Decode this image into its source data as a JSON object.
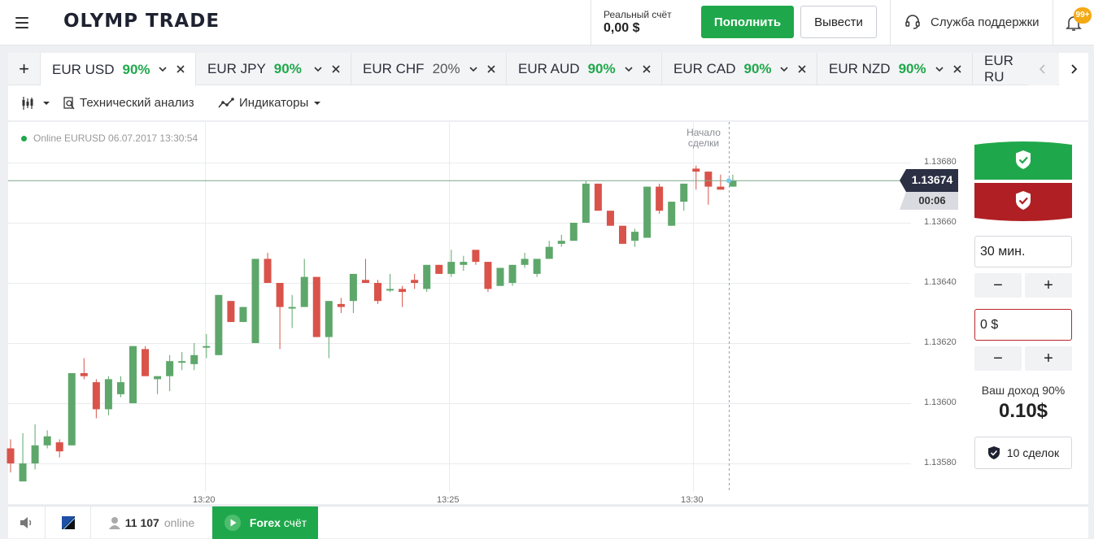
{
  "header": {
    "logo_text": "OLYMP TRADE",
    "account_label": "Реальный счёт",
    "account_balance": "0,00 $",
    "deposit_label": "Пополнить",
    "withdraw_label": "Вывести",
    "support_label": "Служба поддержки",
    "notifications_badge": "99+"
  },
  "tabs": [
    {
      "pair": "EUR USD",
      "payout": "90%",
      "active": true
    },
    {
      "pair": "EUR JPY",
      "payout": "90%"
    },
    {
      "pair": "EUR CHF",
      "payout": "20%"
    },
    {
      "pair": "EUR AUD",
      "payout": "90%"
    },
    {
      "pair": "EUR CAD",
      "payout": "90%"
    },
    {
      "pair": "EUR NZD",
      "payout": "90%"
    },
    {
      "pair": "EUR RU",
      "payout": ""
    }
  ],
  "toolbar": {
    "technical_label": "Технический анализ",
    "indicators_label": "Индикаторы"
  },
  "chart": {
    "online_text": "Online EURUSD 06.07.2017 13:30:54",
    "deal_start_line1": "Начало",
    "deal_start_line2": "сделки",
    "current_price": "1.13674",
    "countdown": "00:06",
    "y_ticks": [
      "1.13680",
      "1.13660",
      "1.13640",
      "1.13620",
      "1.13600",
      "1.13580"
    ],
    "x_ticks": [
      "13:20",
      "13:25",
      "13:30"
    ]
  },
  "chart_data": {
    "type": "candlestick",
    "title": "",
    "ylim": [
      1.13572,
      1.13692
    ],
    "y_ticks": [
      1.1368,
      1.1366,
      1.1364,
      1.1362,
      1.136,
      1.1358
    ],
    "x_ticks": [
      "13:20",
      "13:25",
      "13:30"
    ],
    "current_price": 1.13674,
    "candles": [
      {
        "o": 1.13585,
        "c": 1.1358,
        "h": 1.13588,
        "l": 1.13577
      },
      {
        "o": 1.13574,
        "c": 1.1358,
        "h": 1.1359,
        "l": 1.13578
      },
      {
        "o": 1.1358,
        "c": 1.13586,
        "h": 1.13593,
        "l": 1.13578
      },
      {
        "o": 1.13586,
        "c": 1.13589,
        "h": 1.13591,
        "l": 1.13585
      },
      {
        "o": 1.13587,
        "c": 1.13584,
        "h": 1.13588,
        "l": 1.13582
      },
      {
        "o": 1.13586,
        "c": 1.1361,
        "h": 1.1361,
        "l": 1.13586
      },
      {
        "o": 1.1361,
        "c": 1.13609,
        "h": 1.13615,
        "l": 1.13608
      },
      {
        "o": 1.13607,
        "c": 1.13598,
        "h": 1.13608,
        "l": 1.13595
      },
      {
        "o": 1.13598,
        "c": 1.13608,
        "h": 1.13609,
        "l": 1.13596
      },
      {
        "o": 1.13603,
        "c": 1.13607,
        "h": 1.13609,
        "l": 1.13602
      },
      {
        "o": 1.136,
        "c": 1.13619,
        "h": 1.13619,
        "l": 1.136
      },
      {
        "o": 1.13618,
        "c": 1.13609,
        "h": 1.13619,
        "l": 1.13609
      },
      {
        "o": 1.13608,
        "c": 1.13609,
        "h": 1.13609,
        "l": 1.13603
      },
      {
        "o": 1.13609,
        "c": 1.13614,
        "h": 1.13616,
        "l": 1.13604
      },
      {
        "o": 1.13614,
        "c": 1.13614,
        "h": 1.13617,
        "l": 1.13611
      },
      {
        "o": 1.13613,
        "c": 1.13616,
        "h": 1.1362,
        "l": 1.13611
      },
      {
        "o": 1.13619,
        "c": 1.13619,
        "h": 1.13623,
        "l": 1.13615
      },
      {
        "o": 1.13616,
        "c": 1.13636,
        "h": 1.13636,
        "l": 1.13616
      },
      {
        "o": 1.13634,
        "c": 1.13627,
        "h": 1.13634,
        "l": 1.13627
      },
      {
        "o": 1.13627,
        "c": 1.13632,
        "h": 1.13632,
        "l": 1.13627
      },
      {
        "o": 1.1362,
        "c": 1.13648,
        "h": 1.13648,
        "l": 1.1362
      },
      {
        "o": 1.13648,
        "c": 1.1364,
        "h": 1.1365,
        "l": 1.1364
      },
      {
        "o": 1.1364,
        "c": 1.13632,
        "h": 1.1364,
        "l": 1.13618
      },
      {
        "o": 1.13632,
        "c": 1.13632,
        "h": 1.13636,
        "l": 1.13625
      },
      {
        "o": 1.13632,
        "c": 1.13642,
        "h": 1.13648,
        "l": 1.13632
      },
      {
        "o": 1.13642,
        "c": 1.13622,
        "h": 1.13642,
        "l": 1.13622
      },
      {
        "o": 1.13622,
        "c": 1.13634,
        "h": 1.13634,
        "l": 1.13615
      },
      {
        "o": 1.13633,
        "c": 1.13632,
        "h": 1.13635,
        "l": 1.1363
      },
      {
        "o": 1.13634,
        "c": 1.13643,
        "h": 1.13643,
        "l": 1.1363
      },
      {
        "o": 1.13641,
        "c": 1.1364,
        "h": 1.13648,
        "l": 1.1364
      },
      {
        "o": 1.1364,
        "c": 1.13634,
        "h": 1.13641,
        "l": 1.13633
      },
      {
        "o": 1.13638,
        "c": 1.13638,
        "h": 1.13643,
        "l": 1.13637
      },
      {
        "o": 1.13638,
        "c": 1.13637,
        "h": 1.13639,
        "l": 1.13632
      },
      {
        "o": 1.13641,
        "c": 1.1364,
        "h": 1.13643,
        "l": 1.13638
      },
      {
        "o": 1.13638,
        "c": 1.13646,
        "h": 1.13646,
        "l": 1.13637
      },
      {
        "o": 1.13646,
        "c": 1.13643,
        "h": 1.13646,
        "l": 1.13643
      },
      {
        "o": 1.13643,
        "c": 1.13647,
        "h": 1.13651,
        "l": 1.13642
      },
      {
        "o": 1.13646,
        "c": 1.13647,
        "h": 1.13649,
        "l": 1.13644
      },
      {
        "o": 1.13651,
        "c": 1.13647,
        "h": 1.13651,
        "l": 1.13646
      },
      {
        "o": 1.13647,
        "c": 1.13638,
        "h": 1.13647,
        "l": 1.13637
      },
      {
        "o": 1.13639,
        "c": 1.13645,
        "h": 1.13645,
        "l": 1.13639
      },
      {
        "o": 1.1364,
        "c": 1.13646,
        "h": 1.13646,
        "l": 1.13639
      },
      {
        "o": 1.13646,
        "c": 1.13648,
        "h": 1.1365,
        "l": 1.13645
      },
      {
        "o": 1.13643,
        "c": 1.13648,
        "h": 1.13648,
        "l": 1.13642
      },
      {
        "o": 1.13648,
        "c": 1.13652,
        "h": 1.13654,
        "l": 1.13648
      },
      {
        "o": 1.13653,
        "c": 1.13654,
        "h": 1.13656,
        "l": 1.13652
      },
      {
        "o": 1.13654,
        "c": 1.1366,
        "h": 1.1366,
        "l": 1.13654
      },
      {
        "o": 1.1366,
        "c": 1.13673,
        "h": 1.13674,
        "l": 1.1366
      },
      {
        "o": 1.13673,
        "c": 1.13664,
        "h": 1.13673,
        "l": 1.13664
      },
      {
        "o": 1.13664,
        "c": 1.13659,
        "h": 1.13664,
        "l": 1.13659
      },
      {
        "o": 1.13659,
        "c": 1.13653,
        "h": 1.13659,
        "l": 1.13653
      },
      {
        "o": 1.13654,
        "c": 1.13657,
        "h": 1.13658,
        "l": 1.13652
      },
      {
        "o": 1.13655,
        "c": 1.13672,
        "h": 1.13672,
        "l": 1.13655
      },
      {
        "o": 1.13672,
        "c": 1.13664,
        "h": 1.13673,
        "l": 1.13663
      },
      {
        "o": 1.13659,
        "c": 1.13667,
        "h": 1.13667,
        "l": 1.13659
      },
      {
        "o": 1.13667,
        "c": 1.13673,
        "h": 1.13673,
        "l": 1.13664
      },
      {
        "o": 1.13678,
        "c": 1.13677,
        "h": 1.13679,
        "l": 1.13671
      },
      {
        "o": 1.13677,
        "c": 1.13672,
        "h": 1.13677,
        "l": 1.13666
      },
      {
        "o": 1.13672,
        "c": 1.13671,
        "h": 1.13676,
        "l": 1.13671
      },
      {
        "o": 1.13672,
        "c": 1.13674,
        "h": 1.13676,
        "l": 1.13672
      }
    ]
  },
  "trade": {
    "duration_value": "30 мин.",
    "amount_value": "0 $",
    "income_label": "Ваш доход 90%",
    "income_value": "0.10$",
    "deals_label": "10 сделок"
  },
  "footer": {
    "online_count": "11 107",
    "online_word": "online",
    "forex_bold": "Forex",
    "forex_rest": "счёт"
  },
  "colors": {
    "accent_green": "#1fa84b",
    "candle_up": "#5ea76b",
    "candle_down": "#d9534a",
    "put_red": "#b8252b"
  }
}
